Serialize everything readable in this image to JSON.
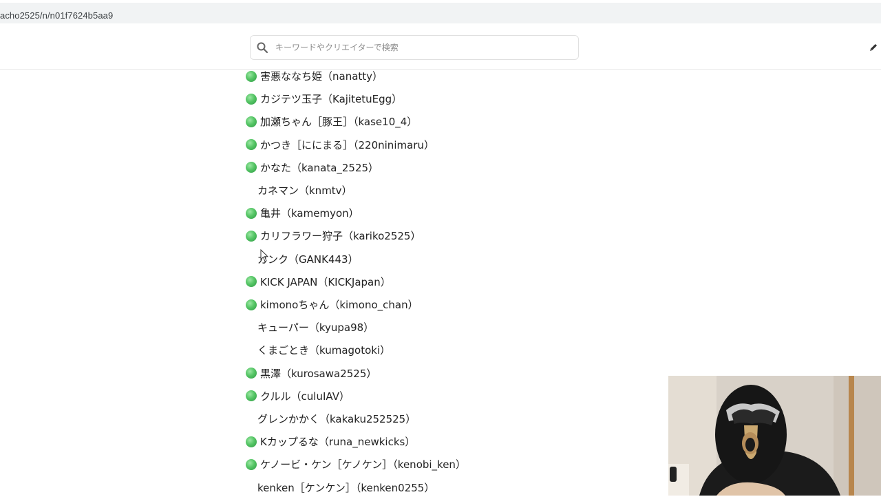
{
  "browser": {
    "url": "acho2525/n/n01f7624b5aa9"
  },
  "header": {
    "search": {
      "placeholder": "キーワードやクリエイターで検索",
      "value": ""
    },
    "icons": [
      "search-icon",
      "pen-icon"
    ]
  },
  "list": {
    "items": [
      {
        "label": "害悪ななち姫（nanatty）",
        "online": true
      },
      {
        "label": "カジテツ玉子（KajitetuEgg）",
        "online": true
      },
      {
        "label": "加瀬ちゃん［豚王］（kase10_4）",
        "online": true
      },
      {
        "label": "かつき［ににまる］（220ninimaru）",
        "online": true
      },
      {
        "label": "かなた（kanata_2525）",
        "online": true
      },
      {
        "label": "カネマン（knmtv）",
        "online": false
      },
      {
        "label": "亀井（kamemyon）",
        "online": true
      },
      {
        "label": "カリフラワー狩子（kariko2525）",
        "online": true
      },
      {
        "label": "ガンク（GANK443）",
        "online": false
      },
      {
        "label": "KICK JAPAN（KICKJapan）",
        "online": true
      },
      {
        "label": "kimonoちゃん（kimono_chan）",
        "online": true
      },
      {
        "label": "キューパー（kyupa98）",
        "online": false
      },
      {
        "label": "くまごとき（kumagotoki）",
        "online": false
      },
      {
        "label": "黒澤（kurosawa2525）",
        "online": true
      },
      {
        "label": "クルル（culuIAV）",
        "online": true
      },
      {
        "label": "グレンかかく（kakaku252525）",
        "online": false
      },
      {
        "label": "Kカップるな（runa_newkicks）",
        "online": true
      },
      {
        "label": "ケノービ・ケン［ケノケン］（kenobi_ken）",
        "online": true
      },
      {
        "label": "kenken［ケンケン］（kenken0255）",
        "online": false
      }
    ]
  },
  "colors": {
    "online_dot": "#4cc35c",
    "text": "#222222",
    "url_bar": "#f1f3f4"
  }
}
